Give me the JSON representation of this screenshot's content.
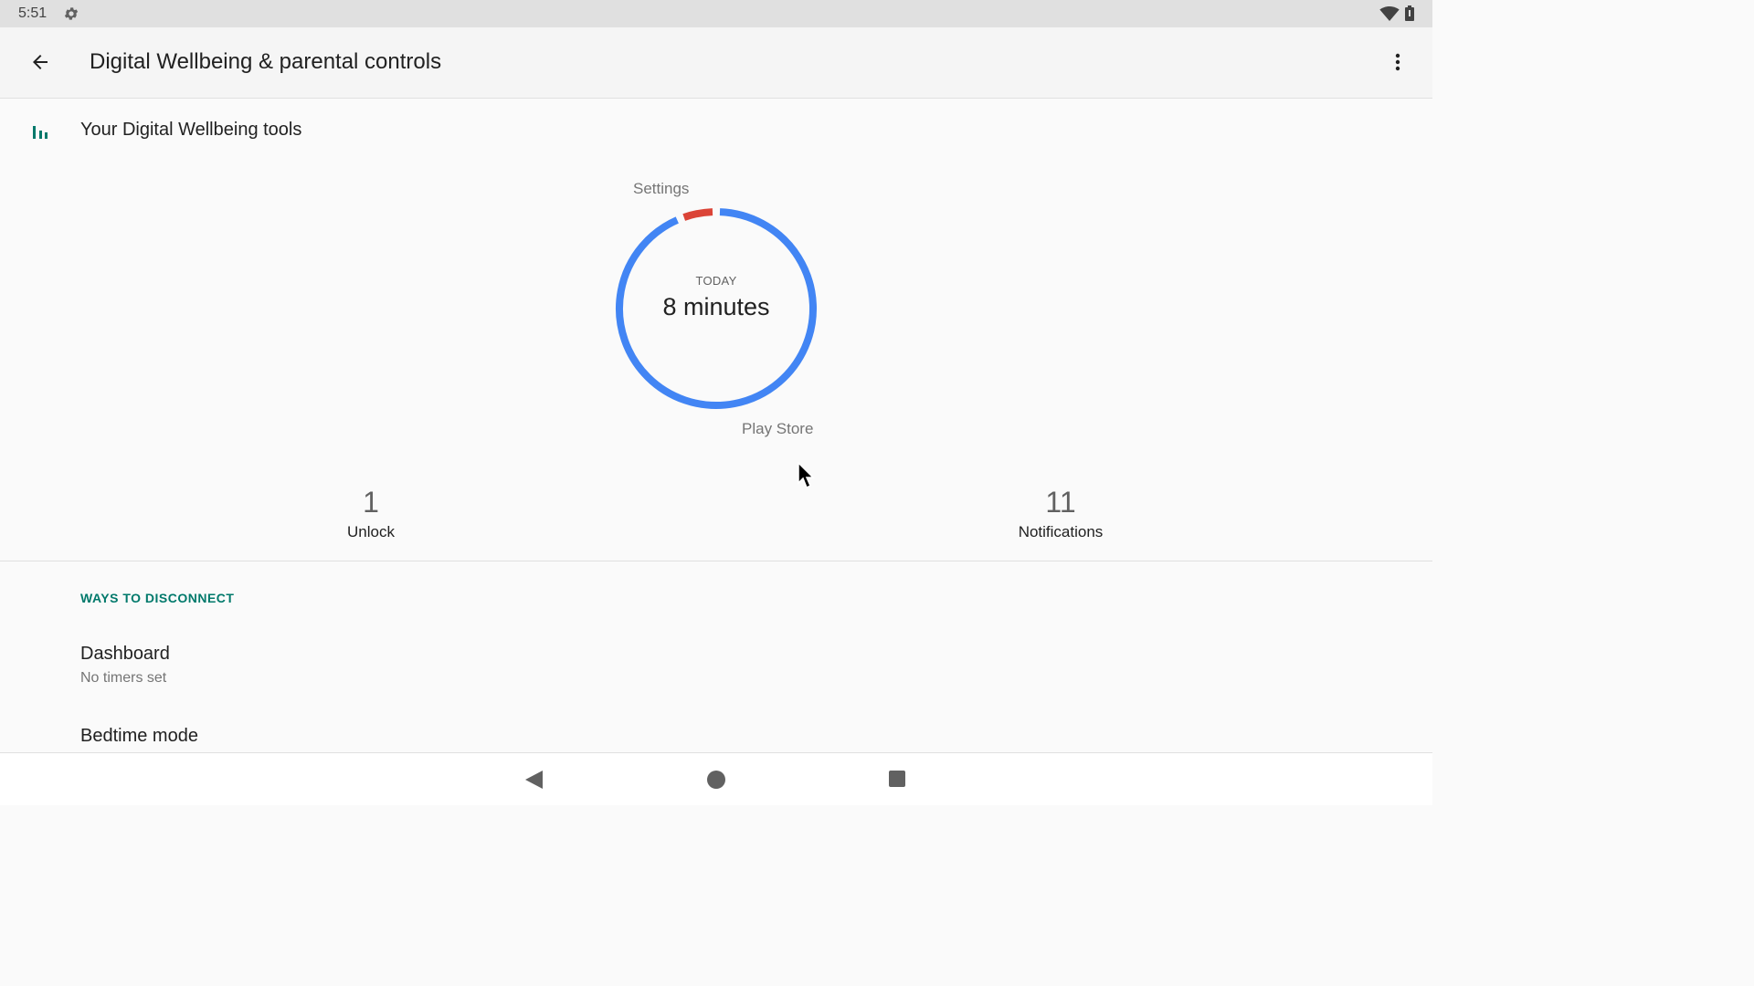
{
  "status_bar": {
    "time": "5:51",
    "icons": [
      "settings-gear-icon",
      "wifi-icon",
      "battery-icon"
    ]
  },
  "app_bar": {
    "title": "Digital Wellbeing & parental controls",
    "back_icon": "arrow-back-icon",
    "menu_icon": "more-vert-icon"
  },
  "tools": {
    "label": "Your Digital Wellbeing tools",
    "icon": "bar-chart-icon"
  },
  "usage_chart": {
    "today_label": "TODAY",
    "total_label": "8 minutes",
    "colors": {
      "play_store": "#4285f4",
      "settings": "#db4437",
      "accent": "#00796b"
    }
  },
  "chart_data": {
    "type": "pie",
    "title": "",
    "slices": [
      {
        "name": "Play Store",
        "fraction": 0.94
      },
      {
        "name": "Settings",
        "fraction": 0.06
      }
    ]
  },
  "stats": {
    "unlocks_value": "1",
    "unlocks_label": "Unlock",
    "notifications_value": "11",
    "notifications_label": "Notifications"
  },
  "section": {
    "header": "WAYS TO DISCONNECT",
    "items": [
      {
        "title": "Dashboard",
        "subtitle": "No timers set"
      },
      {
        "title": "Bedtime mode"
      }
    ]
  },
  "nav_bar": {
    "icons": [
      "nav-back-icon",
      "nav-home-icon",
      "nav-recents-icon"
    ]
  }
}
